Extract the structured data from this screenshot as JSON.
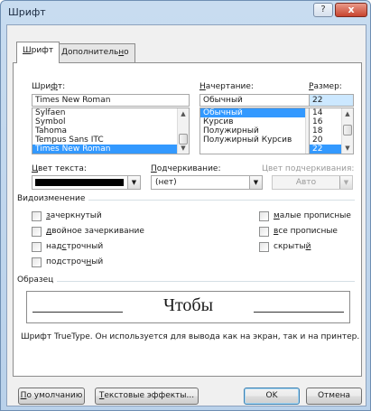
{
  "window": {
    "title": "Шрифт",
    "help_label": "?",
    "close_label": "x"
  },
  "tabs": [
    {
      "label_pre": "",
      "label_key": "Ш",
      "label_post": "рифт"
    },
    {
      "label_pre": "Дополнитель",
      "label_key": "н",
      "label_post": "о"
    }
  ],
  "font": {
    "label_pre": "Шри",
    "label_key": "ф",
    "label_post": "т:",
    "value": "Times New Roman",
    "list": [
      "Sylfaen",
      "Symbol",
      "Tahoma",
      "Tempus Sans ITC",
      "Times New Roman"
    ],
    "selected": "Times New Roman"
  },
  "style": {
    "label_pre": "",
    "label_key": "Н",
    "label_post": "ачертание:",
    "value": "Обычный",
    "list": [
      "Обычный",
      "Курсив",
      "Полужирный",
      "Полужирный Курсив"
    ],
    "selected": "Обычный"
  },
  "size": {
    "label_pre": "",
    "label_key": "Р",
    "label_post": "азмер:",
    "value": "22",
    "list": [
      "14",
      "16",
      "18",
      "20",
      "22"
    ],
    "selected": "22"
  },
  "text_color": {
    "label_pre": "",
    "label_key": "Ц",
    "label_post": "вет текста:",
    "swatch": "#000000"
  },
  "underline": {
    "label_pre": "",
    "label_key": "П",
    "label_post": "одчеркивание:",
    "value": "(нет)"
  },
  "underline_color": {
    "label": "Цвет подчеркивания:",
    "value": "Авто"
  },
  "effects": {
    "title": "Видоизменение",
    "left": [
      {
        "pre": "",
        "key": "з",
        "post": "ачеркнутый"
      },
      {
        "pre": "",
        "key": "д",
        "post": "войное зачеркивание"
      },
      {
        "pre": "над",
        "key": "с",
        "post": "трочный"
      },
      {
        "pre": "подстроч",
        "key": "н",
        "post": "ый"
      }
    ],
    "right": [
      {
        "pre": "",
        "key": "м",
        "post": "алые прописные"
      },
      {
        "pre": "",
        "key": "в",
        "post": "се прописные"
      },
      {
        "pre": "скрыты",
        "key": "й",
        "post": ""
      }
    ]
  },
  "preview": {
    "title": "Образец",
    "sample": "Чтобы",
    "note": "Шрифт TrueType. Он используется для вывода как на экран, так и на принтер."
  },
  "buttons": {
    "default": {
      "pre": "",
      "key": "П",
      "post": "о умолчанию"
    },
    "effects": {
      "pre": "",
      "key": "Т",
      "post": "екстовые эффекты..."
    },
    "ok": "OK",
    "cancel": "Отмена"
  }
}
